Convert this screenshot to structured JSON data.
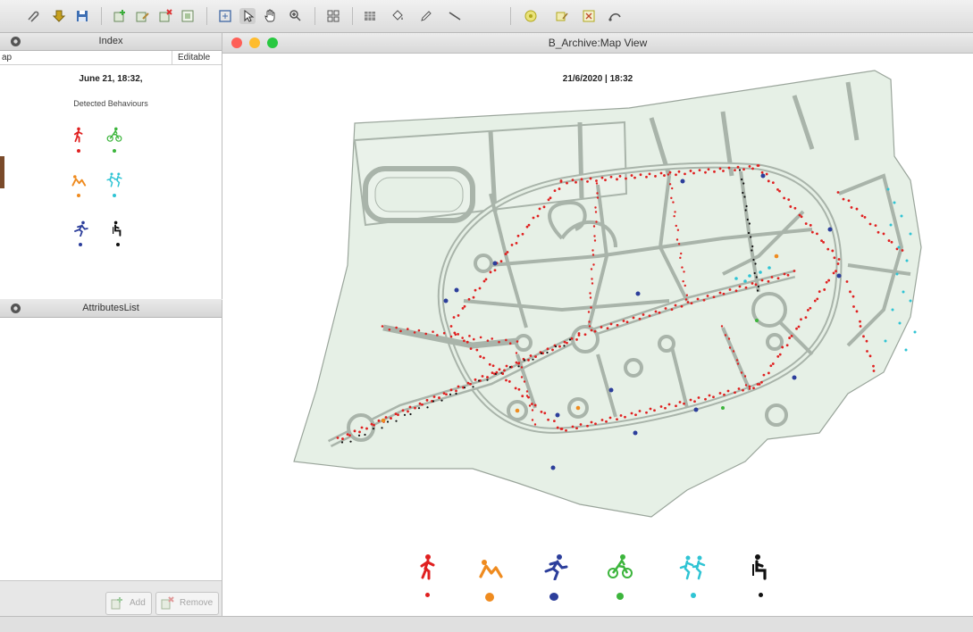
{
  "toolbar": {
    "icons": [
      "attach-icon",
      "download-icon",
      "save-icon",
      "add-layer-icon",
      "edit-layer-icon",
      "remove-layer-icon",
      "layer-props-icon",
      "zoom-extent-icon",
      "select-arrow-icon",
      "pan-hand-icon",
      "zoom-icon",
      "grid-icon",
      "table-icon",
      "bucket-icon",
      "pencil-icon",
      "line-tool-icon",
      "symbol-icon",
      "edit-symbol-icon",
      "label-icon",
      "route-icon"
    ]
  },
  "index_panel": {
    "title": "Index",
    "col_map": "ap",
    "col_editable": "Editable",
    "date": "June 21, 18:32,",
    "subtitle": "Detected Behaviours"
  },
  "attributes_panel": {
    "title": "AttributesList",
    "add_label": "Add",
    "remove_label": "Remove"
  },
  "map_window": {
    "title": "B_Archive:Map View",
    "datetime": "21/6/2020  |  18:32"
  },
  "behaviours": [
    {
      "icon": "walking-person-icon",
      "color": "#e02020"
    },
    {
      "icon": "lying-person-icon",
      "color": "#ef8b1f"
    },
    {
      "icon": "running-person-icon",
      "color": "#2c3e9b"
    },
    {
      "icon": "cyclist-icon",
      "color": "#3cb53c"
    },
    {
      "icon": "running-pair-icon",
      "color": "#2fc4d4"
    },
    {
      "icon": "sitting-person-icon",
      "color": "#111111"
    }
  ],
  "colors": {
    "park_fill": "#e6f0e6",
    "path_stroke": "#a9b4aa",
    "close": "#fe5f57",
    "minimize": "#febc2e",
    "zoom": "#28c840"
  }
}
